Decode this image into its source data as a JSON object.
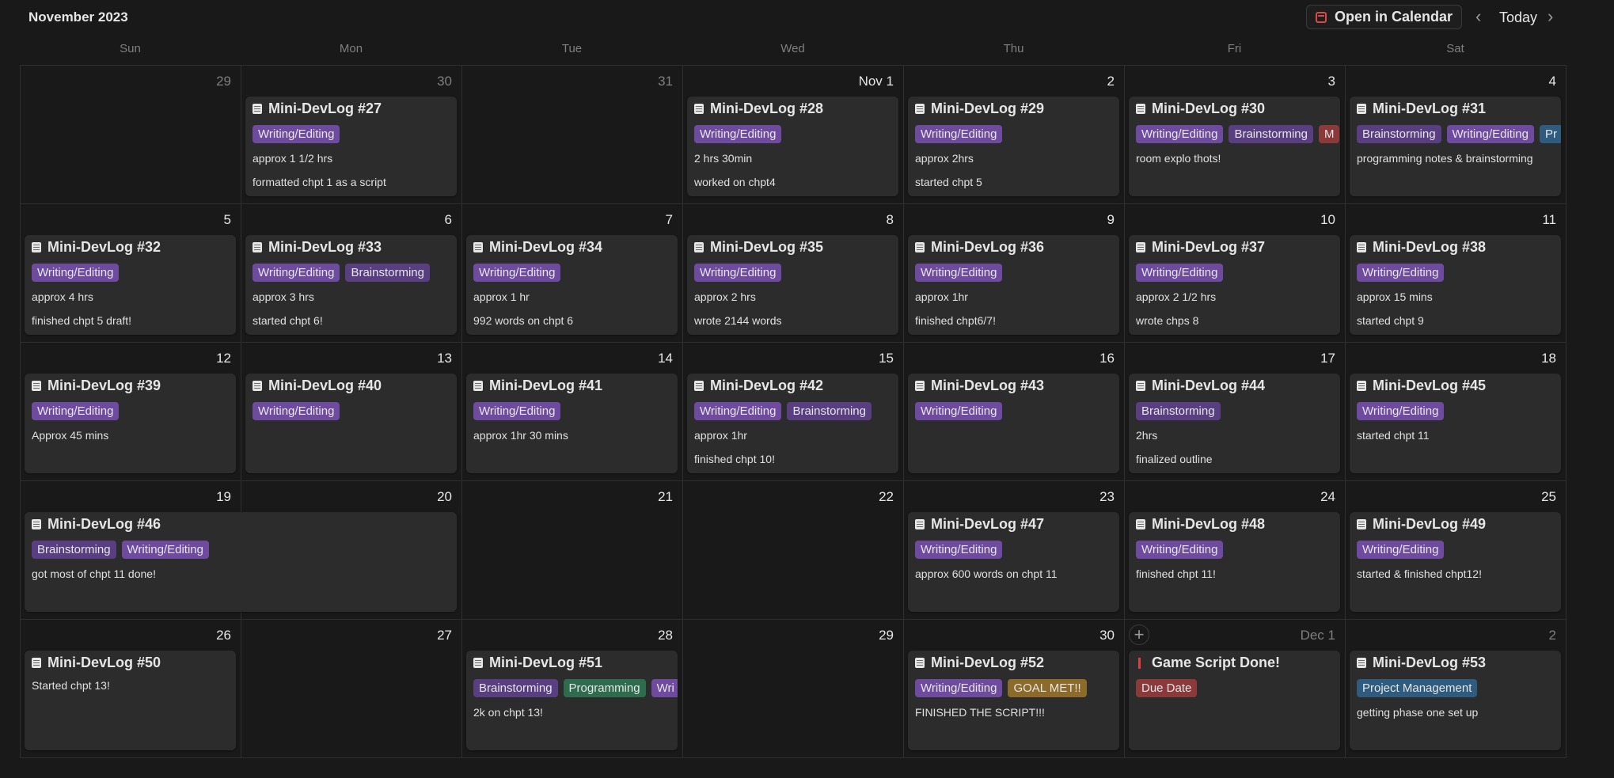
{
  "header": {
    "title": "November 2023",
    "open_calendar": "Open in Calendar",
    "today": "Today",
    "prev_icon": "chevron-left-icon",
    "next_icon": "chevron-right-icon"
  },
  "weekdays": [
    "Sun",
    "Mon",
    "Tue",
    "Wed",
    "Thu",
    "Fri",
    "Sat"
  ],
  "days": [
    {
      "num": "29",
      "dim": true
    },
    {
      "num": "30",
      "dim": true
    },
    {
      "num": "31",
      "dim": true
    },
    {
      "num": "Nov 1"
    },
    {
      "num": "2"
    },
    {
      "num": "3"
    },
    {
      "num": "4"
    },
    {
      "num": "5"
    },
    {
      "num": "6"
    },
    {
      "num": "7"
    },
    {
      "num": "8"
    },
    {
      "num": "9"
    },
    {
      "num": "10"
    },
    {
      "num": "11"
    },
    {
      "num": "12"
    },
    {
      "num": "13"
    },
    {
      "num": "14"
    },
    {
      "num": "15"
    },
    {
      "num": "16"
    },
    {
      "num": "17"
    },
    {
      "num": "18"
    },
    {
      "num": "19"
    },
    {
      "num": "20"
    },
    {
      "num": "21"
    },
    {
      "num": "22"
    },
    {
      "num": "23"
    },
    {
      "num": "24"
    },
    {
      "num": "25"
    },
    {
      "num": "26"
    },
    {
      "num": "27"
    },
    {
      "num": "28"
    },
    {
      "num": "29"
    },
    {
      "num": "30"
    },
    {
      "num": "Dec 1",
      "dim": true,
      "add": true
    },
    {
      "num": "2",
      "dim": true
    }
  ],
  "events": [
    {
      "row": 0,
      "col": 1,
      "span": 1,
      "icon": "note",
      "title": "Mini-DevLog #27",
      "tags": [
        {
          "t": "Writing/Editing",
          "c": "purple"
        }
      ],
      "lines": [
        "approx 1 1/2 hrs",
        "formatted chpt 1 as a script"
      ]
    },
    {
      "row": 0,
      "col": 3,
      "span": 1,
      "icon": "note",
      "title": "Mini-DevLog #28",
      "tags": [
        {
          "t": "Writing/Editing",
          "c": "purple"
        }
      ],
      "lines": [
        "2 hrs 30min",
        "worked on chpt4"
      ]
    },
    {
      "row": 0,
      "col": 4,
      "span": 1,
      "icon": "note",
      "title": "Mini-DevLog #29",
      "tags": [
        {
          "t": "Writing/Editing",
          "c": "purple"
        }
      ],
      "lines": [
        "approx 2hrs",
        "started chpt 5"
      ]
    },
    {
      "row": 0,
      "col": 5,
      "span": 1,
      "icon": "note",
      "title": "Mini-DevLog #30",
      "tags": [
        {
          "t": "Writing/Editing",
          "c": "purple"
        },
        {
          "t": "Brainstorming",
          "c": "purple2"
        },
        {
          "t": "M",
          "c": "red"
        }
      ],
      "lines": [
        "room explo thots!"
      ]
    },
    {
      "row": 0,
      "col": 6,
      "span": 1,
      "icon": "note",
      "title": "Mini-DevLog #31",
      "tags": [
        {
          "t": "Brainstorming",
          "c": "purple2"
        },
        {
          "t": "Writing/Editing",
          "c": "purple"
        },
        {
          "t": "Pr",
          "c": "blue"
        }
      ],
      "lines": [
        "programming notes & brainstorming"
      ]
    },
    {
      "row": 1,
      "col": 0,
      "span": 1,
      "icon": "note",
      "title": "Mini-DevLog #32",
      "tags": [
        {
          "t": "Writing/Editing",
          "c": "purple"
        }
      ],
      "lines": [
        "approx 4 hrs",
        "finished chpt 5 draft!"
      ]
    },
    {
      "row": 1,
      "col": 1,
      "span": 1,
      "icon": "note",
      "title": "Mini-DevLog #33",
      "tags": [
        {
          "t": "Writing/Editing",
          "c": "purple"
        },
        {
          "t": "Brainstorming",
          "c": "purple2"
        }
      ],
      "lines": [
        "approx 3 hrs",
        "started chpt 6!"
      ]
    },
    {
      "row": 1,
      "col": 2,
      "span": 1,
      "icon": "note",
      "title": "Mini-DevLog #34",
      "tags": [
        {
          "t": "Writing/Editing",
          "c": "purple"
        }
      ],
      "lines": [
        "approx 1 hr",
        "992 words on chpt 6"
      ]
    },
    {
      "row": 1,
      "col": 3,
      "span": 1,
      "icon": "note",
      "title": "Mini-DevLog #35",
      "tags": [
        {
          "t": "Writing/Editing",
          "c": "purple"
        }
      ],
      "lines": [
        "approx 2 hrs",
        "wrote 2144 words"
      ]
    },
    {
      "row": 1,
      "col": 4,
      "span": 1,
      "icon": "note",
      "title": "Mini-DevLog #36",
      "tags": [
        {
          "t": "Writing/Editing",
          "c": "purple"
        }
      ],
      "lines": [
        "approx 1hr",
        "finished chpt6/7!"
      ]
    },
    {
      "row": 1,
      "col": 5,
      "span": 1,
      "icon": "note",
      "title": "Mini-DevLog #37",
      "tags": [
        {
          "t": "Writing/Editing",
          "c": "purple"
        }
      ],
      "lines": [
        "approx 2 1/2 hrs",
        "wrote chps 8"
      ]
    },
    {
      "row": 1,
      "col": 6,
      "span": 1,
      "icon": "note",
      "title": "Mini-DevLog #38",
      "tags": [
        {
          "t": "Writing/Editing",
          "c": "purple"
        }
      ],
      "lines": [
        "approx 15 mins",
        "started chpt 9"
      ]
    },
    {
      "row": 2,
      "col": 0,
      "span": 1,
      "icon": "note",
      "title": "Mini-DevLog #39",
      "tags": [
        {
          "t": "Writing/Editing",
          "c": "purple"
        }
      ],
      "lines": [
        "Approx 45 mins"
      ]
    },
    {
      "row": 2,
      "col": 1,
      "span": 1,
      "icon": "note",
      "title": "Mini-DevLog #40",
      "tags": [
        {
          "t": "Writing/Editing",
          "c": "purple"
        }
      ],
      "lines": []
    },
    {
      "row": 2,
      "col": 2,
      "span": 1,
      "icon": "note",
      "title": "Mini-DevLog #41",
      "tags": [
        {
          "t": "Writing/Editing",
          "c": "purple"
        }
      ],
      "lines": [
        "approx 1hr 30 mins"
      ]
    },
    {
      "row": 2,
      "col": 3,
      "span": 1,
      "icon": "note",
      "title": "Mini-DevLog #42",
      "tags": [
        {
          "t": "Writing/Editing",
          "c": "purple"
        },
        {
          "t": "Brainstorming",
          "c": "purple2"
        }
      ],
      "lines": [
        "approx 1hr",
        "finished chpt 10!"
      ]
    },
    {
      "row": 2,
      "col": 4,
      "span": 1,
      "icon": "note",
      "title": "Mini-DevLog #43",
      "tags": [
        {
          "t": "Writing/Editing",
          "c": "purple"
        }
      ],
      "lines": []
    },
    {
      "row": 2,
      "col": 5,
      "span": 1,
      "icon": "note",
      "title": "Mini-DevLog #44",
      "tags": [
        {
          "t": "Brainstorming",
          "c": "purple2"
        }
      ],
      "lines": [
        "2hrs",
        "finalized outline"
      ]
    },
    {
      "row": 2,
      "col": 6,
      "span": 1,
      "icon": "note",
      "title": "Mini-DevLog #45",
      "tags": [
        {
          "t": "Writing/Editing",
          "c": "purple"
        }
      ],
      "lines": [
        "started chpt 11"
      ]
    },
    {
      "row": 3,
      "col": 0,
      "span": 2,
      "icon": "note",
      "title": "Mini-DevLog #46",
      "tags": [
        {
          "t": "Brainstorming",
          "c": "purple2"
        },
        {
          "t": "Writing/Editing",
          "c": "purple"
        }
      ],
      "lines": [
        "got most of chpt 11 done!"
      ]
    },
    {
      "row": 3,
      "col": 4,
      "span": 1,
      "icon": "note",
      "title": "Mini-DevLog #47",
      "tags": [
        {
          "t": "Writing/Editing",
          "c": "purple"
        }
      ],
      "lines": [
        "approx 600 words on chpt 11"
      ]
    },
    {
      "row": 3,
      "col": 5,
      "span": 1,
      "icon": "note",
      "title": "Mini-DevLog #48",
      "tags": [
        {
          "t": "Writing/Editing",
          "c": "purple"
        }
      ],
      "lines": [
        "finished chpt 11!"
      ]
    },
    {
      "row": 3,
      "col": 6,
      "span": 1,
      "icon": "note",
      "title": "Mini-DevLog #49",
      "tags": [
        {
          "t": "Writing/Editing",
          "c": "purple"
        }
      ],
      "lines": [
        "started & finished chpt12!"
      ]
    },
    {
      "row": 4,
      "col": 0,
      "span": 1,
      "icon": "note",
      "title": "Mini-DevLog #50",
      "tags": [],
      "lines": [
        "Started chpt 13!"
      ]
    },
    {
      "row": 4,
      "col": 2,
      "span": 1,
      "icon": "note",
      "title": "Mini-DevLog #51",
      "tags": [
        {
          "t": "Brainstorming",
          "c": "purple2"
        },
        {
          "t": "Programming",
          "c": "green"
        },
        {
          "t": "Wri",
          "c": "purple"
        }
      ],
      "lines": [
        "2k on chpt 13!"
      ]
    },
    {
      "row": 4,
      "col": 4,
      "span": 1,
      "icon": "note",
      "title": "Mini-DevLog #52",
      "tags": [
        {
          "t": "Writing/Editing",
          "c": "purple"
        },
        {
          "t": "GOAL MET!!",
          "c": "yellow"
        }
      ],
      "lines": [
        "FINISHED THE SCRIPT!!!"
      ]
    },
    {
      "row": 4,
      "col": 5,
      "span": 1,
      "icon": "pin",
      "title": "Game Script Done!",
      "tags": [
        {
          "t": "Due Date",
          "c": "red"
        }
      ],
      "lines": []
    },
    {
      "row": 4,
      "col": 6,
      "span": 1,
      "icon": "note",
      "title": "Mini-DevLog #53",
      "tags": [
        {
          "t": "Project Management",
          "c": "blue"
        }
      ],
      "lines": [
        "getting phase one set up"
      ]
    }
  ]
}
